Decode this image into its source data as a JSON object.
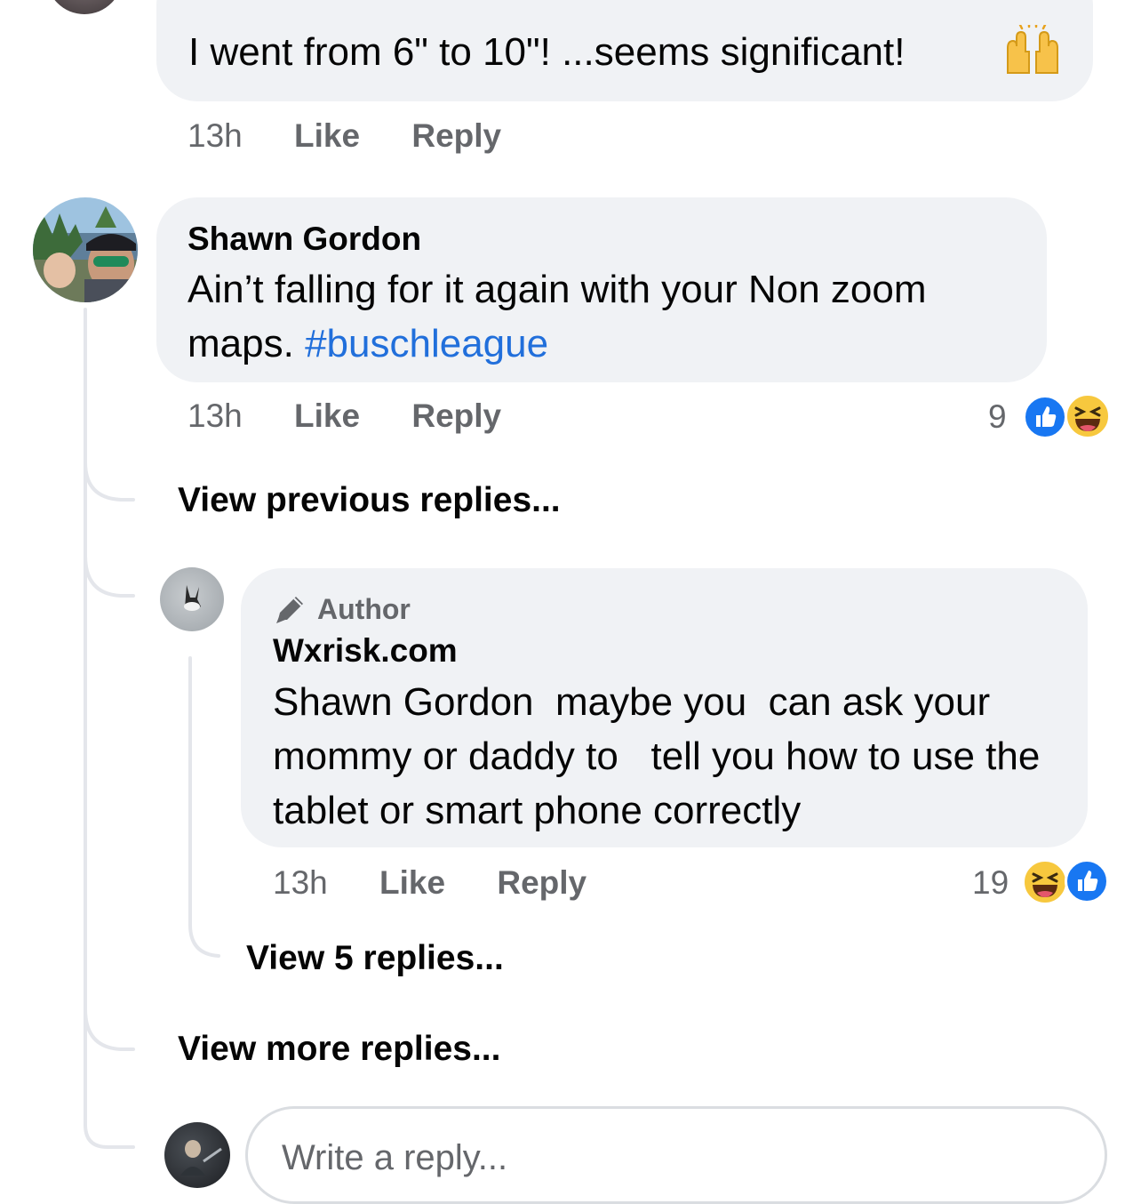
{
  "comment1": {
    "text": "I went from 6\" to 10\"! ...seems significant!",
    "emoji": "raising-hands-icon",
    "time": "13h",
    "like": "Like",
    "reply": "Reply"
  },
  "comment2": {
    "author": "Shawn Gordon",
    "text": "Ain’t falling for it again with your Non zoom maps.",
    "hashtag": "#buschleague",
    "time": "13h",
    "like": "Like",
    "reply": "Reply",
    "reaction_count": "9",
    "reactions": [
      "like-reaction-icon",
      "haha-reaction-icon"
    ]
  },
  "view_previous": "View previous replies...",
  "reply1": {
    "badge": "Author",
    "author": "Wxrisk.com",
    "text": "Shawn Gordon  maybe you  can ask your mommy or daddy to   tell you how to use the  tablet or smart phone correctly",
    "time": "13h",
    "like": "Like",
    "reply": "Reply",
    "reaction_count": "19",
    "reactions": [
      "haha-reaction-icon",
      "like-reaction-icon"
    ]
  },
  "view_replies": "View 5 replies...",
  "view_more": "View more replies...",
  "composer": {
    "placeholder": "Write a reply..."
  },
  "colors": {
    "bubble": "#f0f2f5",
    "link": "#216fdb",
    "meta": "#65676b",
    "like_blue": "#1877f2",
    "haha_yellow": "#f7c83e"
  }
}
